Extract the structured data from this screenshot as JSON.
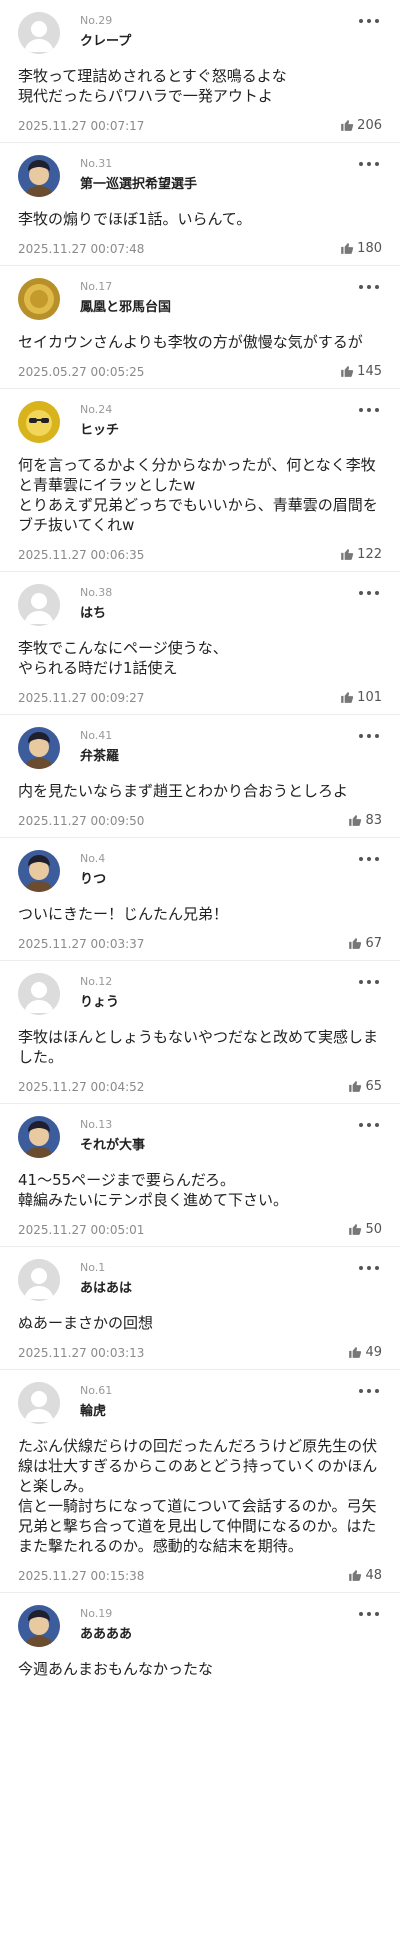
{
  "comments": [
    {
      "number": "No.29",
      "username": "クレープ",
      "text": "李牧って理詰めされるとすぐ怒鳴るよな\n現代だったらパワハラで一発アウトよ",
      "timestamp": "2025.11.27 00:07:17",
      "likes": "206",
      "avatar": "default-avatar-icon"
    },
    {
      "number": "No.31",
      "username": "第一巡選択希望選手",
      "text": "李牧の煽りでほぼ1話。いらんて。",
      "timestamp": "2025.11.27 00:07:48",
      "likes": "180",
      "avatar": "character-avatar-icon"
    },
    {
      "number": "No.17",
      "username": "鳳凰と邪馬台国",
      "text": "セイカウンさんよりも李牧の方が傲慢な気がするが",
      "timestamp": "2025.05.27 00:05:25",
      "likes": "145",
      "avatar": "gold-emblem-avatar-icon"
    },
    {
      "number": "No.24",
      "username": "ヒッチ",
      "text": "何を言ってるかよく分からなかったが、何となく李牧と青華雲にイラッとしたw\nとりあえず兄弟どっちでもいいから、青華雲の眉間をブチ抜いてくれw",
      "timestamp": "2025.11.27 00:06:35",
      "likes": "122",
      "avatar": "sunglasses-avatar-icon"
    },
    {
      "number": "No.38",
      "username": "はち",
      "text": "李牧でこんなにページ使うな、\nやられる時だけ1話使え",
      "timestamp": "2025.11.27 00:09:27",
      "likes": "101",
      "avatar": "default-avatar-icon"
    },
    {
      "number": "No.41",
      "username": "弁茶羅",
      "text": "内を見たいならまず趙王とわかり合おうとしろよ",
      "timestamp": "2025.11.27 00:09:50",
      "likes": "83",
      "avatar": "character-avatar-icon"
    },
    {
      "number": "No.4",
      "username": "りつ",
      "text": "ついにきたー！じんたん兄弟！",
      "timestamp": "2025.11.27 00:03:37",
      "likes": "67",
      "avatar": "character-avatar-icon"
    },
    {
      "number": "No.12",
      "username": "りょう",
      "text": "李牧はほんとしょうもないやつだなと改めて実感しました。",
      "timestamp": "2025.11.27 00:04:52",
      "likes": "65",
      "avatar": "default-avatar-icon"
    },
    {
      "number": "No.13",
      "username": "それが大事",
      "text": "41～55ページまで要らんだろ。\n韓編みたいにテンポ良く進めて下さい。",
      "timestamp": "2025.11.27 00:05:01",
      "likes": "50",
      "avatar": "character-avatar-icon"
    },
    {
      "number": "No.1",
      "username": "あはあは",
      "text": "ぬあーまさかの回想",
      "timestamp": "2025.11.27 00:03:13",
      "likes": "49",
      "avatar": "default-avatar-icon"
    },
    {
      "number": "No.61",
      "username": "輪虎",
      "text": "たぶん伏線だらけの回だったんだろうけど原先生の伏線は壮大すぎるからこのあとどう持っていくのかほんと楽しみ。\n信と一騎討ちになって道について会話するのか。弓矢兄弟と撃ち合って道を見出して仲間になるのか。はたまた撃たれるのか。感動的な結末を期待。",
      "timestamp": "2025.11.27 00:15:38",
      "likes": "48",
      "avatar": "default-avatar-icon"
    },
    {
      "number": "No.19",
      "username": "ああああ",
      "text": "今週あんまおもんなかったな",
      "timestamp": "",
      "likes": "",
      "avatar": "character-avatar-icon"
    }
  ]
}
